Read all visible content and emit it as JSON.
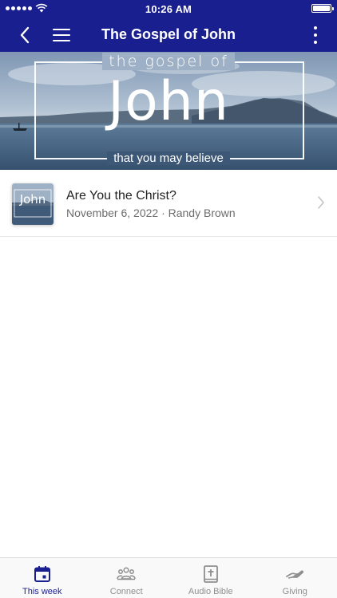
{
  "status_bar": {
    "time": "10:26 AM"
  },
  "nav": {
    "title": "The Gospel of John",
    "back_icon": "chevron-left-icon",
    "menu_icon": "hamburger-menu-icon",
    "more_icon": "vertical-dots-icon"
  },
  "hero": {
    "top_text": "the gospel of",
    "main_text": "John",
    "bottom_text": "that you may believe"
  },
  "list": {
    "items": [
      {
        "title": "Are You the Christ?",
        "subtitle": "November 6, 2022 · Randy Brown",
        "thumbnail_text": "John"
      }
    ]
  },
  "tabs": [
    {
      "label": "This week",
      "icon": "calendar-icon",
      "active": true
    },
    {
      "label": "Connect",
      "icon": "people-icon",
      "active": false
    },
    {
      "label": "Audio Bible",
      "icon": "bible-icon",
      "active": false
    },
    {
      "label": "Giving",
      "icon": "giving-hand-icon",
      "active": false
    }
  ],
  "colors": {
    "brand": "#1a1f8f",
    "inactive_tab": "#8e8e8e",
    "subtitle": "#6d6d6d"
  }
}
